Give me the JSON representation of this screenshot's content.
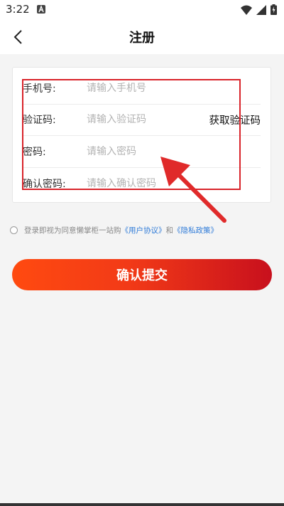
{
  "status_bar": {
    "time": "3:22"
  },
  "nav": {
    "title": "注册"
  },
  "form": {
    "phone": {
      "label": "手机号:",
      "placeholder": "请输入手机号"
    },
    "code": {
      "label": "验证码:",
      "placeholder": "请输入验证码",
      "button": "获取验证码"
    },
    "password": {
      "label": "密码:",
      "placeholder": "请输入密码"
    },
    "confirm": {
      "label": "确认密码:",
      "placeholder": "请输入确认密码"
    }
  },
  "agreement": {
    "prefix": "登录即视为同意懒掌柜一站购",
    "user_agreement": "《用户协议》",
    "and": "和",
    "privacy_policy": "《隐私政策》"
  },
  "submit": {
    "label": "确认提交"
  },
  "colors": {
    "accent": "#f23a17",
    "annotation": "#d9232a",
    "link": "#2f7bd8"
  }
}
